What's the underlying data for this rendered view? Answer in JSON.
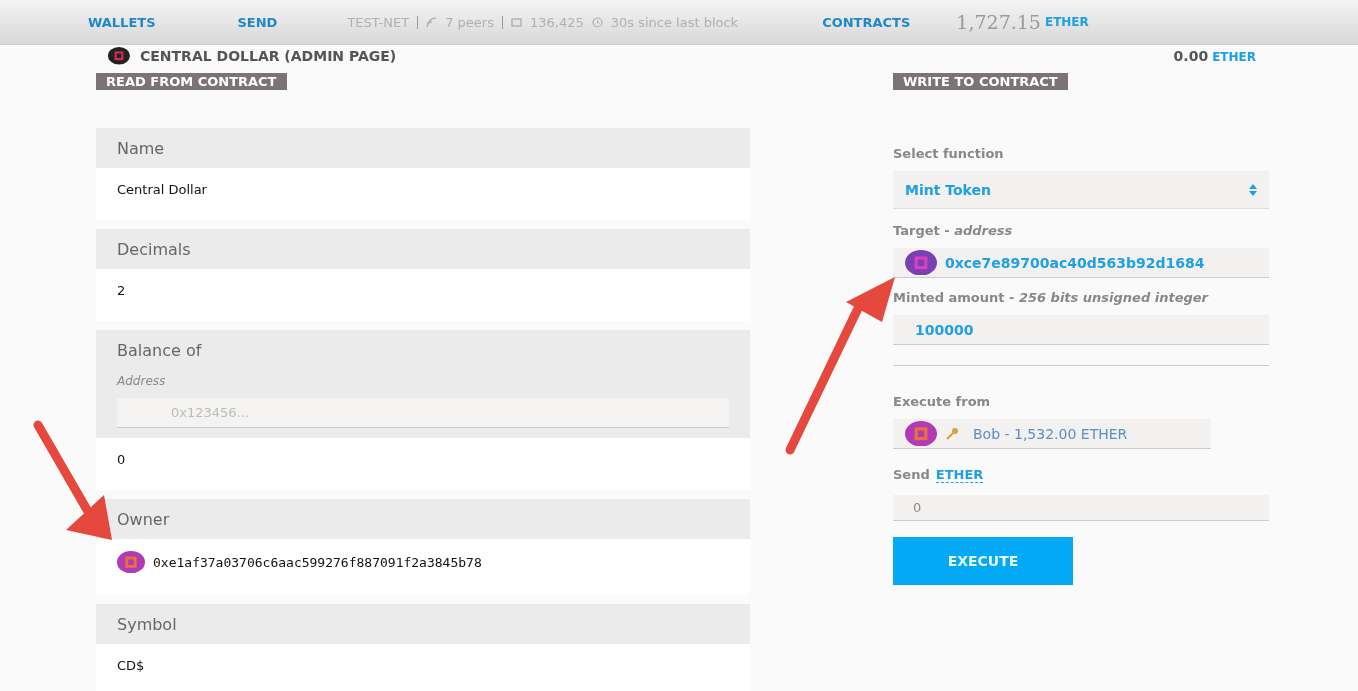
{
  "nav": {
    "links": [
      {
        "label": "WALLETS"
      },
      {
        "label": "SEND"
      }
    ],
    "status": {
      "network": "TEST-NET",
      "peers": "7 peers",
      "block": "136,425",
      "since": "30s since last block"
    },
    "contracts_link": "CONTRACTS",
    "balance": "1,727.15",
    "unit": "ETHER"
  },
  "contract": {
    "title": "CENTRAL DOLLAR (ADMIN PAGE)",
    "balance": "0.00",
    "unit": "ETHER"
  },
  "read": {
    "heading": "READ FROM CONTRACT",
    "items": [
      {
        "kind": "text",
        "label": "Name",
        "value": "Central Dollar"
      },
      {
        "kind": "text",
        "label": "Decimals",
        "value": "2"
      },
      {
        "kind": "input",
        "label": "Balance of",
        "param": "Address",
        "placeholder": "0x123456...",
        "value": "0"
      },
      {
        "kind": "address",
        "label": "Owner",
        "value": "0xe1af37a03706c6aac599276f887091f2a3845b78"
      },
      {
        "kind": "text",
        "label": "Symbol",
        "value": "CD$"
      }
    ]
  },
  "write": {
    "heading": "WRITE TO CONTRACT",
    "select_label": "Select function",
    "function": "Mint Token",
    "params": [
      {
        "kind": "address",
        "label": "Target - *address*",
        "value": "0xce7e89700ac40d563b92d1684"
      },
      {
        "kind": "number",
        "label": "Minted amount - *256 bits unsigned integer*",
        "value": "100000"
      }
    ],
    "execute_from_label": "Execute from",
    "account": "Bob - 1,532.00 ETHER",
    "send_label": "Send",
    "send_unit": "ETHER",
    "send_placeholder": "0",
    "button": "EXECUTE"
  }
}
